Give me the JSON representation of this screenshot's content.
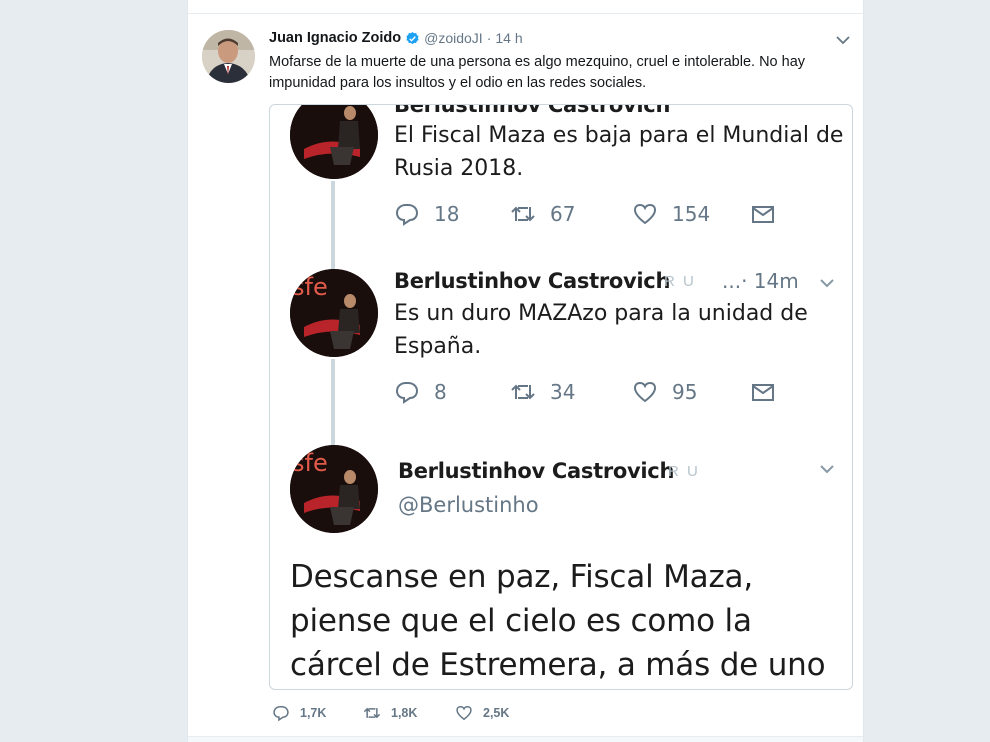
{
  "outer_tweet": {
    "author_name": "Juan Ignacio Zoido",
    "handle": "@zoidoJI",
    "separator": "·",
    "time": "14 h",
    "text": "Mofarse de la muerte de una persona es algo mezquino, cruel e intolerable. No hay impunidad para los insultos y el odio en las redes sociales.",
    "stats": {
      "replies": "1,7K",
      "retweets": "1,8K",
      "likes": "2,5K"
    }
  },
  "embedded": {
    "tweet1": {
      "name_partial": "Berlustinhov Castrovich",
      "text": "El Fiscal Maza es baja para el Mundial de Rusia 2018.",
      "stats": {
        "replies": "18",
        "retweets": "67",
        "likes": "154"
      }
    },
    "tweet2": {
      "name": "Berlustinhov Castrovich",
      "badges": "R U",
      "time": "...· 14m",
      "text": "Es un duro MAZAzo para la unidad de España.",
      "stats": {
        "replies": "8",
        "retweets": "34",
        "likes": "95"
      }
    },
    "tweet3": {
      "name": "Berlustinhov Castrovich",
      "badges": "R U",
      "handle": "@Berlustinho",
      "text": "Descanse en paz, Fiscal Maza, piense que el cielo es como la cárcel de Estremera, a más de uno"
    }
  },
  "avatar_sign_text": "sfe",
  "icons": [
    "verified-icon",
    "chevron-down-icon",
    "reply-icon",
    "retweet-icon",
    "like-icon",
    "message-icon"
  ],
  "colors": {
    "verified": "#1da1f2",
    "muted": "#657786",
    "border": "#ccd6dd",
    "background": "#e6ecf0"
  }
}
